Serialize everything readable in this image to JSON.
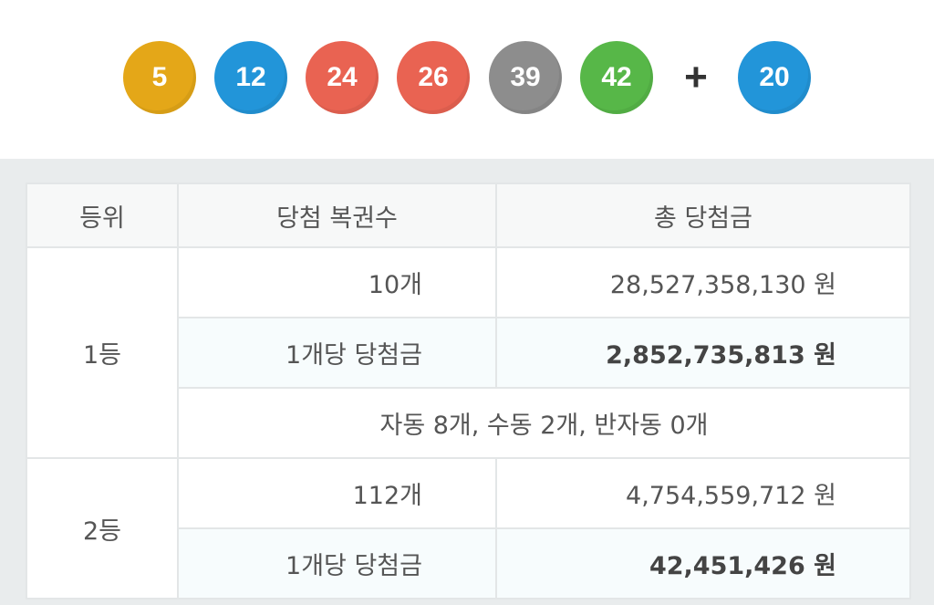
{
  "balls": [
    {
      "number": "5",
      "color": "#e4a718"
    },
    {
      "number": "12",
      "color": "#2295d9"
    },
    {
      "number": "24",
      "color": "#e96352"
    },
    {
      "number": "26",
      "color": "#e96352"
    },
    {
      "number": "39",
      "color": "#8d8d8d"
    },
    {
      "number": "42",
      "color": "#57b748"
    }
  ],
  "plus_symbol": "+",
  "bonus_ball": {
    "number": "20",
    "color": "#2295d9"
  },
  "table": {
    "headers": {
      "rank": "등위",
      "tickets": "당첨 복권수",
      "total": "총 당첨금"
    },
    "rank1": {
      "label": "1등",
      "count": "10개",
      "total": "28,527,358,130 원",
      "per_label": "1개당 당첨금",
      "per_amount": "2,852,735,813 원",
      "breakdown": "자동 8개, 수동 2개, 반자동 0개"
    },
    "rank2": {
      "label": "2등",
      "count": "112개",
      "total": "4,754,559,712 원",
      "per_label": "1개당 당첨금",
      "per_amount": "42,451,426 원"
    }
  }
}
